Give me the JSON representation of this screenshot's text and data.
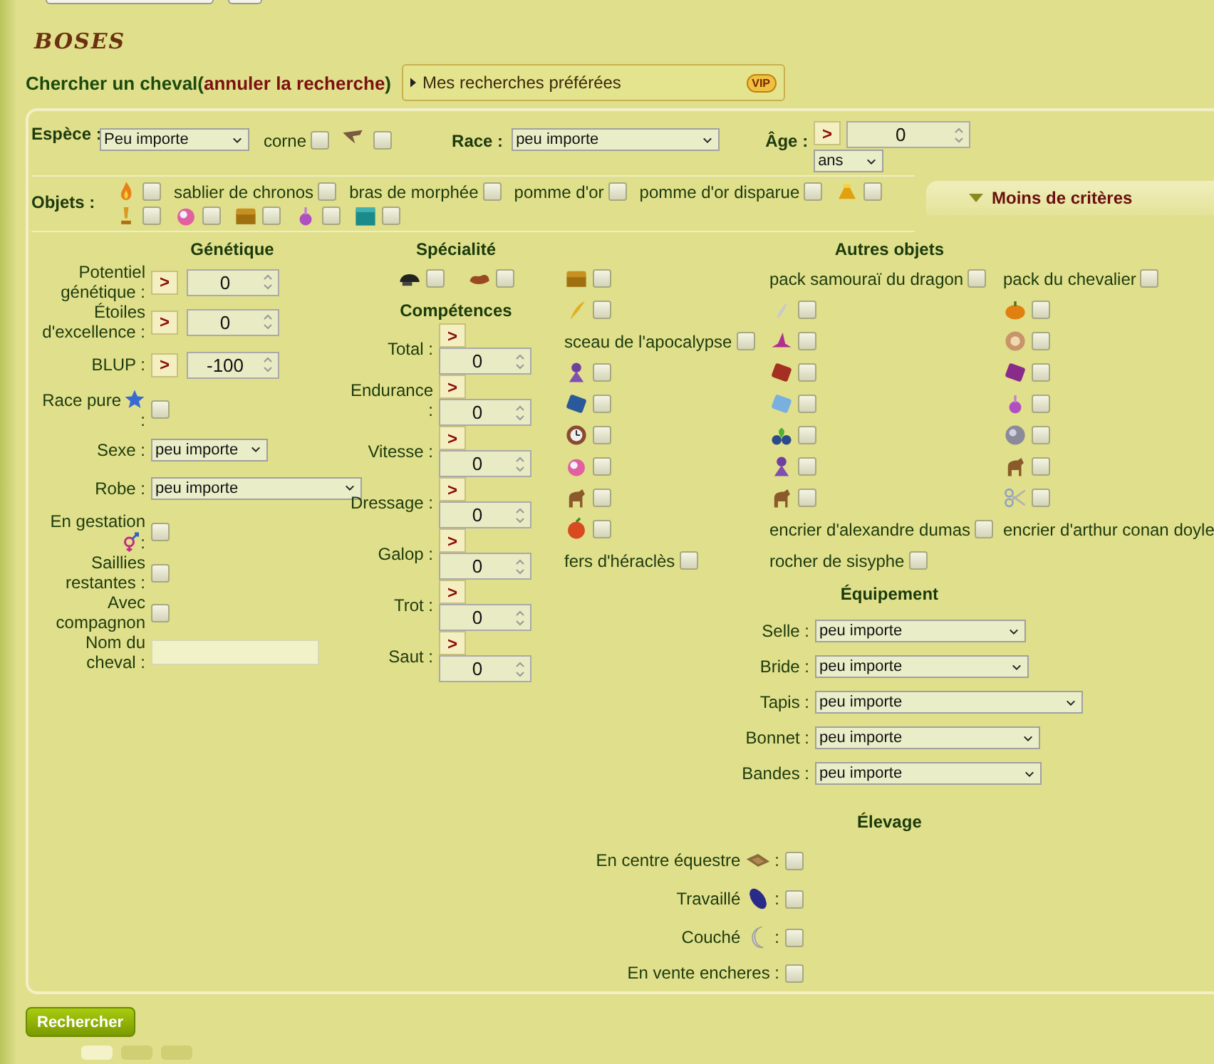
{
  "title": "BOSES",
  "search": {
    "label": "Chercher un cheval(",
    "cancel_link": "annuler la recherche",
    "closing": ")"
  },
  "favorites": {
    "label": "Mes recherches préférées",
    "badge": "VIP"
  },
  "filters": {
    "species": {
      "label": "Espèce :",
      "value": "Peu importe"
    },
    "horn": {
      "label": "corne",
      "checked": false
    },
    "wings": {
      "checked": false
    },
    "race": {
      "label": "Race :",
      "value": "peu importe"
    },
    "age": {
      "label": "Âge :",
      "operator": ">",
      "value": "0",
      "unit": "ans"
    }
  },
  "objects": {
    "label": "Objets :",
    "items": [
      {
        "checked": false
      },
      {
        "label": "sablier de chronos",
        "checked": false
      },
      {
        "label": "bras de morphée",
        "checked": false
      },
      {
        "label": "pomme d'or",
        "checked": false
      },
      {
        "label": "pomme d'or disparue",
        "checked": false
      },
      {
        "checked": false
      },
      {
        "checked": false
      },
      {
        "checked": false
      },
      {
        "checked": false
      },
      {
        "checked": false
      },
      {
        "checked": false
      }
    ]
  },
  "toggle_tab": {
    "label": "Moins de critères",
    "expanded": true
  },
  "genetics": {
    "title": "Génétique",
    "rows": [
      {
        "kind": "number",
        "label": "Potentiel génétique :",
        "operator": ">",
        "value": "0"
      },
      {
        "kind": "number",
        "label": "Étoiles d'excellence :",
        "operator": ">",
        "value": "0"
      },
      {
        "kind": "number",
        "label": "BLUP :",
        "operator": ">",
        "value": "-100"
      },
      {
        "kind": "check",
        "label": "Race pure",
        "after": ":",
        "checked": false
      },
      {
        "kind": "select",
        "label": "Sexe :",
        "value": "peu importe"
      },
      {
        "kind": "select",
        "label": "Robe :",
        "value": "peu importe"
      },
      {
        "kind": "check",
        "label": "En gestation",
        "after": ":",
        "checked": false
      },
      {
        "kind": "check",
        "label": "Saillies restantes :",
        "checked": false
      },
      {
        "kind": "check",
        "label": "Avec compagnon",
        "checked": false
      },
      {
        "kind": "text",
        "label": "Nom du cheval :"
      }
    ]
  },
  "specialty": {
    "title": "Spécialité",
    "items": [
      {
        "checked": false
      },
      {
        "checked": false
      }
    ]
  },
  "skills": {
    "title": "Compétences",
    "rows": [
      {
        "label": "Total :",
        "operator": ">",
        "value": "0"
      },
      {
        "label": "Endurance :",
        "operator": ">",
        "value": "0"
      },
      {
        "label": "Vitesse :",
        "operator": ">",
        "value": "0"
      },
      {
        "label": "Dressage :",
        "operator": ">",
        "value": "0"
      },
      {
        "label": "Galop :",
        "operator": ">",
        "value": "0"
      },
      {
        "label": "Trot :",
        "operator": ">",
        "value": "0"
      },
      {
        "label": "Saut :",
        "operator": ">",
        "value": "0"
      }
    ]
  },
  "other_objects": {
    "title": "Autres objets",
    "items": [
      {
        "checked": false
      },
      {
        "label": "pack samouraï du dragon",
        "checked": false
      },
      {
        "label": "pack du chevalier",
        "checked": false
      },
      {
        "checked": false
      },
      {
        "checked": false
      },
      {
        "checked": false
      },
      {
        "label": "sceau de l'apocalypse",
        "checked": false
      },
      {
        "checked": false
      },
      {
        "checked": false
      },
      {
        "checked": false
      },
      {
        "checked": false
      },
      {
        "checked": false
      },
      {
        "checked": false
      },
      {
        "checked": false
      },
      {
        "checked": false
      },
      {
        "checked": false
      },
      {
        "checked": false
      },
      {
        "checked": false
      },
      {
        "checked": false
      },
      {
        "checked": false
      },
      {
        "checked": false
      },
      {
        "checked": false
      },
      {
        "checked": false
      },
      {
        "checked": false
      },
      {
        "checked": false
      },
      {
        "label": "encrier d'alexandre dumas",
        "checked": false
      },
      {
        "label": "encrier d'arthur conan doyle"
      },
      {
        "label": "fers d'héraclès",
        "checked": false
      },
      {
        "label": "rocher de sisyphe",
        "checked": false
      }
    ]
  },
  "equipment": {
    "title": "Équipement",
    "rows": [
      {
        "label": "Selle :",
        "value": "peu importe"
      },
      {
        "label": "Bride :",
        "value": "peu importe"
      },
      {
        "label": "Tapis :",
        "value": "peu importe"
      },
      {
        "label": "Bonnet :",
        "value": "peu importe"
      },
      {
        "label": "Bandes :",
        "value": "peu importe"
      }
    ]
  },
  "breeding": {
    "title": "Élevage",
    "rows": [
      {
        "label": "En centre équestre",
        "after": ":",
        "checked": false
      },
      {
        "label": "Travaillé",
        "after": ":",
        "checked": false
      },
      {
        "label": "Couché",
        "after": ":",
        "checked": false
      },
      {
        "label": "En vente encheres :",
        "checked": false
      }
    ]
  },
  "submit": "Rechercher"
}
